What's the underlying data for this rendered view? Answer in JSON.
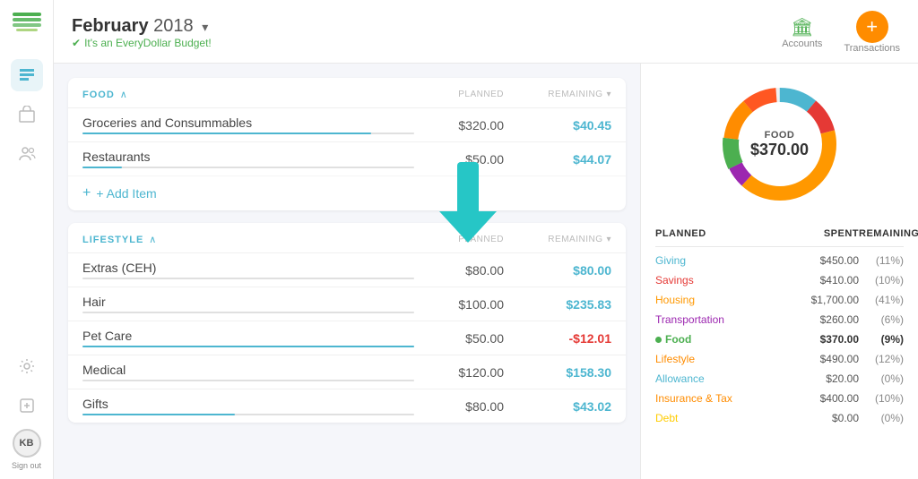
{
  "sidebar": {
    "logo_text": "💲",
    "avatar_initials": "KB",
    "sign_out": "Sign out",
    "items": [
      {
        "name": "budget-icon",
        "label": "Budget",
        "active": true
      },
      {
        "name": "box-icon",
        "label": "Box"
      },
      {
        "name": "people-icon",
        "label": "People"
      },
      {
        "name": "settings-icon",
        "label": "Settings"
      },
      {
        "name": "gear-icon",
        "label": "Gear"
      }
    ]
  },
  "header": {
    "month": "February",
    "year": "2018",
    "subtitle": "It's an EveryDollar Budget!",
    "nav": [
      {
        "label": "Accounts",
        "icon": "🏛"
      },
      {
        "label": "Transactions",
        "icon": "+"
      }
    ]
  },
  "food_section": {
    "category_name": "FOOD",
    "col_planned": "PLANNED",
    "col_remaining": "REMAINING",
    "items": [
      {
        "name": "Groceries and Consummables",
        "planned": "$320.00",
        "remaining": "$40.45",
        "remaining_type": "positive",
        "progress": 87
      },
      {
        "name": "Restaurants",
        "planned": "$50.00",
        "remaining": "$44.07",
        "remaining_type": "positive",
        "progress": 12
      }
    ],
    "add_item_label": "+ Add Item"
  },
  "lifestyle_section": {
    "category_name": "LIFESTYLE",
    "col_planned": "PLANNED",
    "col_remaining": "REMAINING",
    "items": [
      {
        "name": "Extras (CEH)",
        "planned": "$80.00",
        "remaining": "$80.00",
        "remaining_type": "positive",
        "progress": 0
      },
      {
        "name": "Hair",
        "planned": "$100.00",
        "remaining": "$235.83",
        "remaining_type": "positive",
        "progress": 0
      },
      {
        "name": "Pet Care",
        "planned": "$50.00",
        "remaining": "-$12.01",
        "remaining_type": "negative",
        "progress": 100
      },
      {
        "name": "Medical",
        "planned": "$120.00",
        "remaining": "$158.30",
        "remaining_type": "positive",
        "progress": 0
      },
      {
        "name": "Gifts",
        "planned": "$80.00",
        "remaining": "$43.02",
        "remaining_type": "positive",
        "progress": 46
      }
    ]
  },
  "donut": {
    "label": "FOOD",
    "amount": "$370.00"
  },
  "summary": {
    "headers": {
      "planned": "PLANNED",
      "spent": "SPENT",
      "remaining": "REMAINING"
    },
    "rows": [
      {
        "category": "Giving",
        "class": "giving",
        "planned": "$450.00",
        "spent": "",
        "remaining": "(11%)"
      },
      {
        "category": "Savings",
        "class": "savings",
        "planned": "$410.00",
        "spent": "",
        "remaining": "(10%)"
      },
      {
        "category": "Housing",
        "class": "housing",
        "planned": "$1,700.00",
        "spent": "",
        "remaining": "(41%)"
      },
      {
        "category": "Transportation",
        "class": "transportation",
        "planned": "$260.00",
        "spent": "",
        "remaining": "(6%)"
      },
      {
        "category": "Food",
        "class": "food",
        "planned": "$370.00",
        "spent": "",
        "remaining": "(9%)",
        "bold": true
      },
      {
        "category": "Lifestyle",
        "class": "lifestyle",
        "planned": "$490.00",
        "spent": "",
        "remaining": "(12%)"
      },
      {
        "category": "Allowance",
        "class": "allowance",
        "planned": "$20.00",
        "spent": "",
        "remaining": "(0%)"
      },
      {
        "category": "Insurance & Tax",
        "class": "insurance",
        "planned": "$400.00",
        "spent": "",
        "remaining": "(10%)"
      },
      {
        "category": "Debt",
        "class": "debt",
        "planned": "$0.00",
        "spent": "",
        "remaining": "(0%)"
      }
    ]
  },
  "colors": {
    "giving": "#4db6d0",
    "savings": "#e53935",
    "housing": "#ff9800",
    "transportation": "#9c27b0",
    "food": "#4caf50",
    "lifestyle": "#ff8c00",
    "allowance": "#4db6d0",
    "insurance": "#ff8c00",
    "debt": "#ffcc00"
  }
}
